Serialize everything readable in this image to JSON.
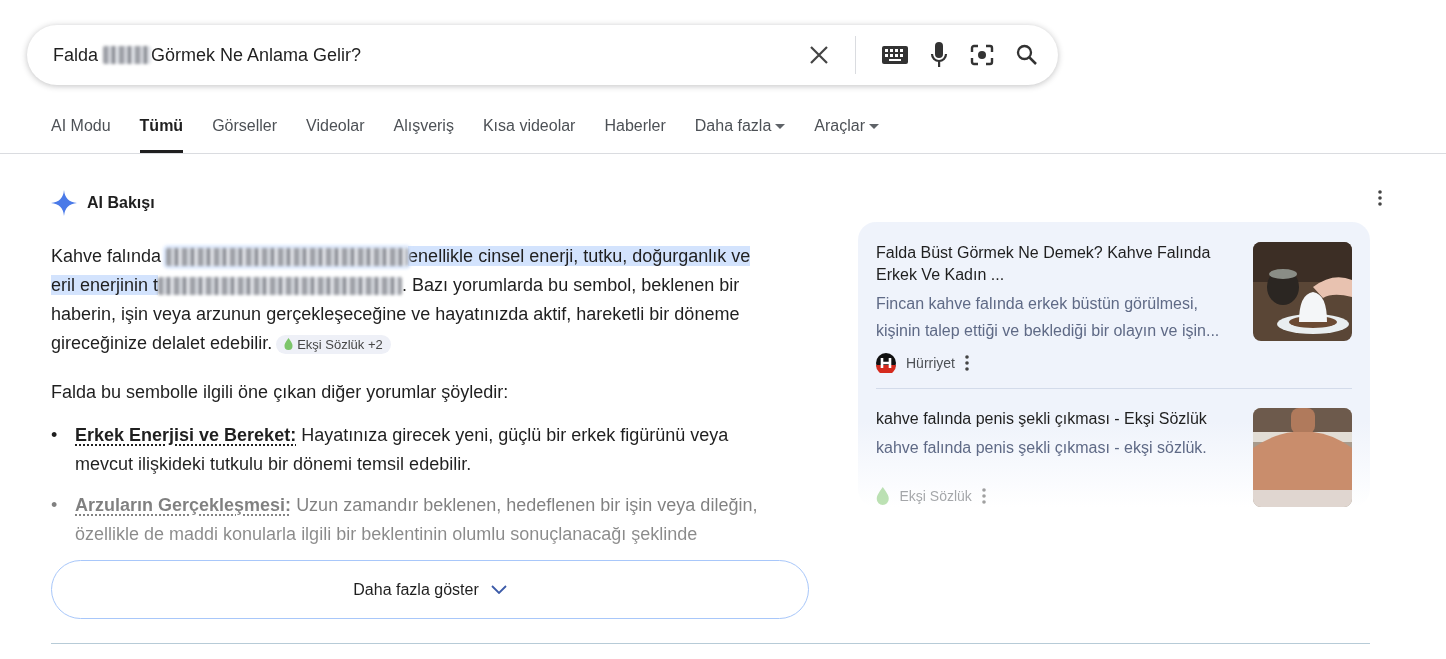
{
  "search": {
    "segments": [
      {
        "kind": "text",
        "text": "Falda "
      },
      {
        "kind": "blur"
      },
      {
        "kind": "text",
        "text": "Görmek Ne Anlama Gelir?"
      }
    ]
  },
  "tabs": [
    {
      "label": "AI Modu",
      "selected": false,
      "dropdown": false
    },
    {
      "label": "Tümü",
      "selected": true,
      "dropdown": false
    },
    {
      "label": "Görseller",
      "selected": false,
      "dropdown": false
    },
    {
      "label": "Videolar",
      "selected": false,
      "dropdown": false
    },
    {
      "label": "Alışveriş",
      "selected": false,
      "dropdown": false
    },
    {
      "label": "Kısa videolar",
      "selected": false,
      "dropdown": false
    },
    {
      "label": "Haberler",
      "selected": false,
      "dropdown": false
    },
    {
      "label": "Daha fazla",
      "selected": false,
      "dropdown": true
    },
    {
      "label": "Araçlar",
      "selected": false,
      "dropdown": true
    }
  ],
  "overview": {
    "title": "AI Bakışı",
    "paragraph": [
      {
        "kind": "text",
        "text": "Kahve falında ",
        "highlighted": false
      },
      {
        "kind": "blur",
        "highlighted": true
      },
      {
        "kind": "text",
        "text": "enellikle cinsel enerji, tutku, doğurganlık ve eril enerjinin t",
        "highlighted": true
      },
      {
        "kind": "blur",
        "highlighted": false
      },
      {
        "kind": "text",
        "text": ". Bazı yorumlarda bu sembol, beklenen bir haberin, işin veya arzunun gerçekleşeceğine ve hayatınızda aktif, hareketli bir döneme gireceğinize delalet edebilir.",
        "highlighted": false
      }
    ],
    "source_chip": "Ekşi Sözlük +2",
    "intro": "Falda bu sembolle ilgili öne çıkan diğer yorumlar şöyledir:",
    "bullets": [
      {
        "marker": "•",
        "term": "Erkek Enerjisi ve Bereket:",
        "text": "Hayatınıza girecek yeni, güçlü bir erkek figürünü veya mevcut ilişkideki tutkulu bir dönemi temsil edebilir."
      },
      {
        "marker": "•",
        "term": "Arzuların Gerçekleşmesi:",
        "text": "Uzun zamandır beklenen, hedeflenen bir işin veya dileğin, özellikle de maddi konularla ilgili bir beklentinin olumlu sonuçlanacağı şeklinde"
      }
    ],
    "show_more": "Daha fazla göster"
  },
  "sources": [
    {
      "title": "Falda Büst Görmek Ne Demek? Kahve Falında Erkek Ve Kadın ...",
      "snippet": "Fincan kahve falında erkek büstün görülmesi, kişinin talep ettiği ve beklediği bir olayın ve işin...",
      "site": "Hürriyet",
      "kind": "letter"
    },
    {
      "title": "kahve falında penis şekli çıkması - Ekşi Sözlük",
      "snippet": "kahve falında penis şekli çıkması - ekşi sözlük.",
      "site": "Ekşi Sözlük",
      "kind": "drop"
    }
  ]
}
